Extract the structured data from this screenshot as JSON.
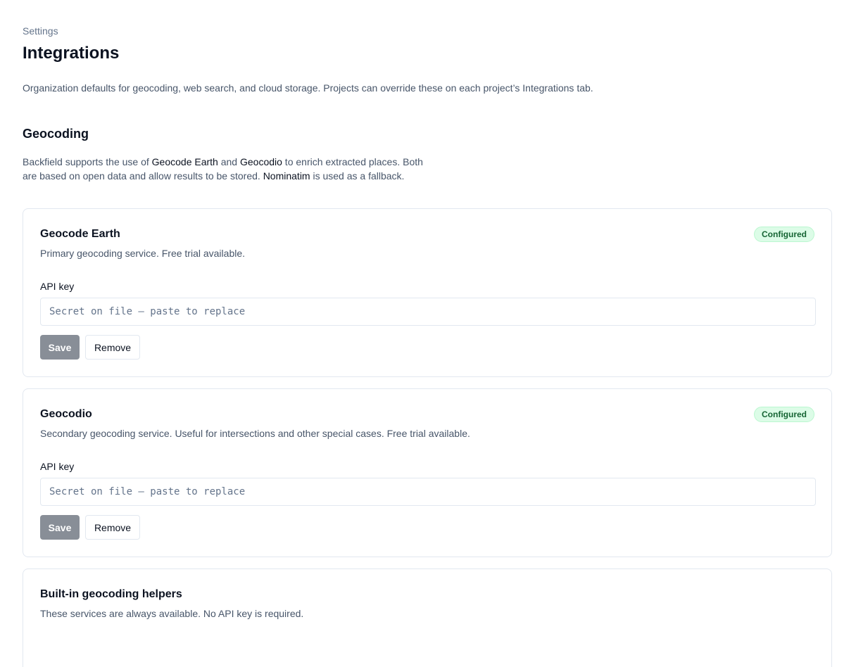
{
  "breadcrumb": "Settings",
  "page_title": "Integrations",
  "page_description": "Organization defaults for geocoding, web search, and cloud storage. Projects can override these on each project’s Integrations tab.",
  "geocoding": {
    "title": "Geocoding",
    "description": {
      "part1": "Backfield supports the use of ",
      "service1": "Geocode Earth",
      "part2": " and ",
      "service2": "Geocodio",
      "part3": " to enrich extracted places. Both are based on open data and allow results to be stored. ",
      "fallback": "Nominatim",
      "part4": " is used as a fallback."
    },
    "providers": [
      {
        "name": "Geocode Earth",
        "description": "Primary geocoding service. Free trial available.",
        "status": "Configured",
        "field_label": "API key",
        "placeholder": "Secret on file — paste to replace",
        "save_label": "Save",
        "remove_label": "Remove"
      },
      {
        "name": "Geocodio",
        "description": "Secondary geocoding service. Useful for intersections and other special cases. Free trial available.",
        "status": "Configured",
        "field_label": "API key",
        "placeholder": "Secret on file — paste to replace",
        "save_label": "Save",
        "remove_label": "Remove"
      }
    ],
    "builtin": {
      "title": "Built-in geocoding helpers",
      "description": "These services are always available. No API key is required."
    }
  },
  "colors": {
    "status_configured_bg": "#dcfce7",
    "status_configured_text": "#166534",
    "save_button_bg": "#888e97"
  }
}
